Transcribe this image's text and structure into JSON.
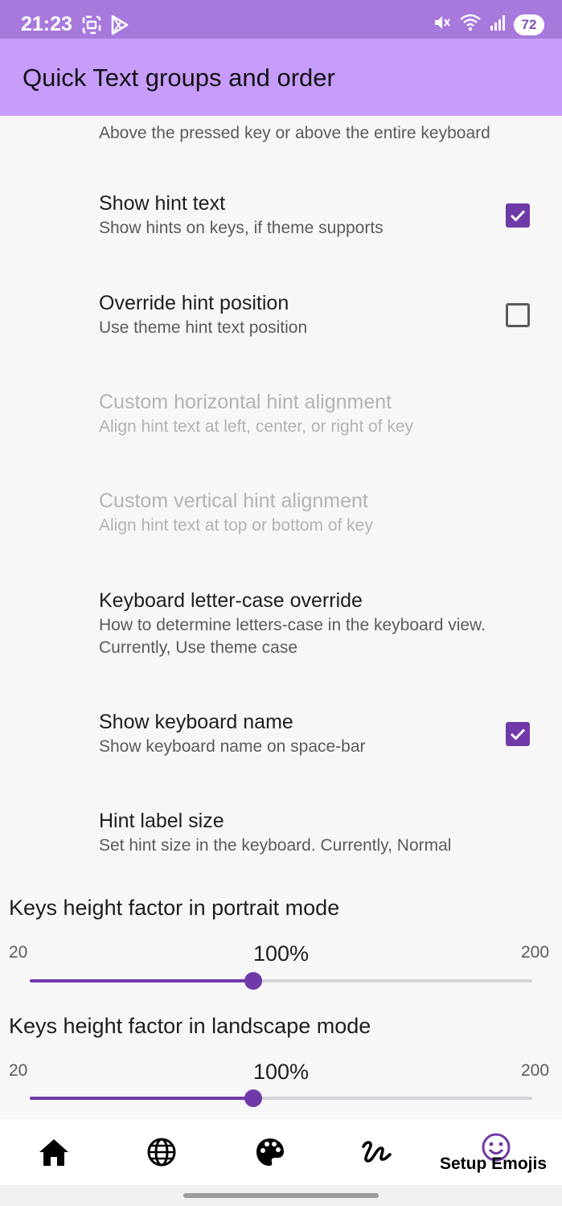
{
  "status_bar": {
    "time": "21:23",
    "battery": "72",
    "icons": [
      "screenshot-icon",
      "play-store-icon",
      "mute-icon",
      "wifi-icon",
      "signal-icon"
    ]
  },
  "app_bar": {
    "title": "Quick Text groups and order"
  },
  "preferences": [
    {
      "title": "",
      "summary": "Above the pressed key or above the entire keyboard",
      "enabled": true
    },
    {
      "title": "Show hint text",
      "summary": "Show hints on keys, if theme supports",
      "checked": true,
      "enabled": true
    },
    {
      "title": "Override hint position",
      "summary": "Use theme hint text position",
      "checked": false,
      "enabled": true
    },
    {
      "title": "Custom horizontal hint alignment",
      "summary": "Align hint text at left, center, or right of key",
      "enabled": false
    },
    {
      "title": "Custom vertical hint alignment",
      "summary": "Align hint text at top or bottom of key",
      "enabled": false
    },
    {
      "title": "Keyboard letter-case override",
      "summary_line1": "How to determine letters-case in the keyboard view.",
      "summary_line2": "Currently, Use theme case",
      "enabled": true
    },
    {
      "title": "Show keyboard name",
      "summary": "Show keyboard name on space-bar",
      "checked": true,
      "enabled": true
    },
    {
      "title": "Hint label size",
      "summary": "Set hint size in the keyboard. Currently, Normal",
      "enabled": true
    }
  ],
  "sliders": [
    {
      "title": "Keys height factor in portrait mode",
      "min": "20",
      "max": "200",
      "value_label": "100%",
      "fraction": 0.444
    },
    {
      "title": "Keys height factor in landscape mode",
      "min": "20",
      "max": "200",
      "value_label": "100%",
      "fraction": 0.444
    }
  ],
  "bottom_nav": {
    "items": [
      "home-icon",
      "globe-icon",
      "palette-icon",
      "gesture-icon",
      "emoji-icon"
    ],
    "active_label": "Setup Emojis"
  },
  "colors": {
    "accent": "#6f3aa7",
    "app_bar": "#c79cfb",
    "status_bar": "#a779dd"
  }
}
